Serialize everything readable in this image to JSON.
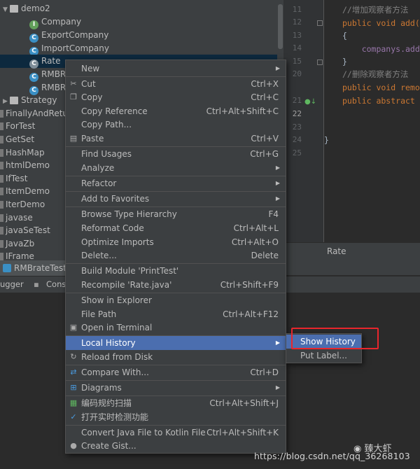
{
  "tree": {
    "items": [
      {
        "label": "demo2",
        "icon": "package-icon"
      },
      {
        "label": "Company",
        "icon": "interface-icon"
      },
      {
        "label": "ExportCompany",
        "icon": "class-icon"
      },
      {
        "label": "ImportCompany",
        "icon": "class-icon"
      },
      {
        "label": "Rate",
        "icon": "abstract-class-icon"
      },
      {
        "label": "RMBRa",
        "icon": "class-icon"
      },
      {
        "label": "RMBRa",
        "icon": "class-icon"
      },
      {
        "label": "Strategy",
        "icon": "package-icon"
      },
      {
        "label": "FinallyAndReturn",
        "icon": "folder-icon"
      },
      {
        "label": "ForTest",
        "icon": "folder-icon"
      },
      {
        "label": "GetSet",
        "icon": "folder-icon"
      },
      {
        "label": "HashMap",
        "icon": "folder-icon"
      },
      {
        "label": "htmlDemo",
        "icon": "folder-icon"
      },
      {
        "label": "IfTest",
        "icon": "folder-icon"
      },
      {
        "label": "ItemDemo",
        "icon": "folder-icon"
      },
      {
        "label": "IterDemo",
        "icon": "folder-icon"
      },
      {
        "label": "javase",
        "icon": "folder-icon"
      },
      {
        "label": "javaSeTest",
        "icon": "folder-icon"
      },
      {
        "label": "JavaZb",
        "icon": "folder-icon"
      },
      {
        "label": "IFrame",
        "icon": "folder-icon"
      }
    ]
  },
  "editor": {
    "line_numbers": [
      "11",
      "12",
      "13",
      "14",
      "15",
      "20",
      "21",
      "22",
      "23",
      "24",
      "25"
    ],
    "lines": [
      {
        "text": "//增加观察者方法",
        "kind": "comment"
      },
      {
        "text": "public void add(C",
        "kind": "method"
      },
      {
        "text": "{",
        "kind": "plain"
      },
      {
        "text": "    companys.add(",
        "kind": "field"
      },
      {
        "text": "}",
        "kind": "plain"
      },
      {
        "text": "//删除观察者方法",
        "kind": "comment"
      },
      {
        "text": "public void remov",
        "kind": "method"
      },
      {
        "text": "public abstract v",
        "kind": "abstract"
      },
      {
        "text": "",
        "kind": "plain"
      },
      {
        "text": "}",
        "kind": "plain"
      },
      {
        "text": "",
        "kind": "plain"
      }
    ],
    "tab_label": "Rate"
  },
  "run_tab": {
    "label": "RMBrateTest"
  },
  "tool_tabs": [
    "ugger",
    "Conso"
  ],
  "menu": {
    "items": [
      {
        "label": "New",
        "shortcut": "",
        "submenu": true,
        "icon": ""
      },
      {
        "label": "Cut",
        "shortcut": "Ctrl+X",
        "submenu": false,
        "icon": "scissors-icon"
      },
      {
        "label": "Copy",
        "shortcut": "Ctrl+C",
        "submenu": false,
        "icon": "copy-icon"
      },
      {
        "label": "Copy Reference",
        "shortcut": "Ctrl+Alt+Shift+C",
        "submenu": false,
        "icon": ""
      },
      {
        "label": "Copy Path...",
        "shortcut": "",
        "submenu": false,
        "icon": ""
      },
      {
        "label": "Paste",
        "shortcut": "Ctrl+V",
        "submenu": false,
        "icon": "paste-icon"
      },
      {
        "label": "Find Usages",
        "shortcut": "Ctrl+G",
        "submenu": false,
        "icon": ""
      },
      {
        "label": "Analyze",
        "shortcut": "",
        "submenu": true,
        "icon": ""
      },
      {
        "label": "Refactor",
        "shortcut": "",
        "submenu": true,
        "icon": ""
      },
      {
        "label": "Add to Favorites",
        "shortcut": "",
        "submenu": true,
        "icon": ""
      },
      {
        "label": "Browse Type Hierarchy",
        "shortcut": "F4",
        "submenu": false,
        "icon": ""
      },
      {
        "label": "Reformat Code",
        "shortcut": "Ctrl+Alt+L",
        "submenu": false,
        "icon": ""
      },
      {
        "label": "Optimize Imports",
        "shortcut": "Ctrl+Alt+O",
        "submenu": false,
        "icon": ""
      },
      {
        "label": "Delete...",
        "shortcut": "Delete",
        "submenu": false,
        "icon": ""
      },
      {
        "label": "Build Module 'PrintTest'",
        "shortcut": "",
        "submenu": false,
        "icon": ""
      },
      {
        "label": "Recompile 'Rate.java'",
        "shortcut": "Ctrl+Shift+F9",
        "submenu": false,
        "icon": ""
      },
      {
        "label": "Show in Explorer",
        "shortcut": "",
        "submenu": false,
        "icon": ""
      },
      {
        "label": "File Path",
        "shortcut": "Ctrl+Alt+F12",
        "submenu": false,
        "icon": ""
      },
      {
        "label": "Open in Terminal",
        "shortcut": "",
        "submenu": false,
        "icon": "terminal-icon"
      },
      {
        "label": "Local History",
        "shortcut": "",
        "submenu": true,
        "icon": "",
        "highlighted": true
      },
      {
        "label": "Reload from Disk",
        "shortcut": "",
        "submenu": false,
        "icon": "reload-icon"
      },
      {
        "label": "Compare With...",
        "shortcut": "Ctrl+D",
        "submenu": false,
        "icon": "compare-icon"
      },
      {
        "label": "Diagrams",
        "shortcut": "",
        "submenu": true,
        "icon": "diagram-icon"
      },
      {
        "label": "编码规约扫描",
        "shortcut": "Ctrl+Alt+Shift+J",
        "submenu": false,
        "icon": "scan-icon"
      },
      {
        "label": "打开实时检测功能",
        "shortcut": "",
        "submenu": false,
        "icon": "realtime-check-icon"
      },
      {
        "label": "Convert Java File to Kotlin File",
        "shortcut": "Ctrl+Alt+Shift+K",
        "submenu": false,
        "icon": ""
      },
      {
        "label": "Create Gist...",
        "shortcut": "",
        "submenu": false,
        "icon": "github-icon"
      }
    ]
  },
  "submenu": {
    "items": [
      {
        "label": "Show History",
        "highlighted": true
      },
      {
        "label": "Put Label..."
      }
    ]
  },
  "watermark": {
    "brand": "臻大虾",
    "url": "https://blog.csdn.net/qq_36268103"
  },
  "colors": {
    "highlight": "#4b6eaf",
    "annotation_box": "#e8262c",
    "menu_bg": "#3c3f41"
  }
}
